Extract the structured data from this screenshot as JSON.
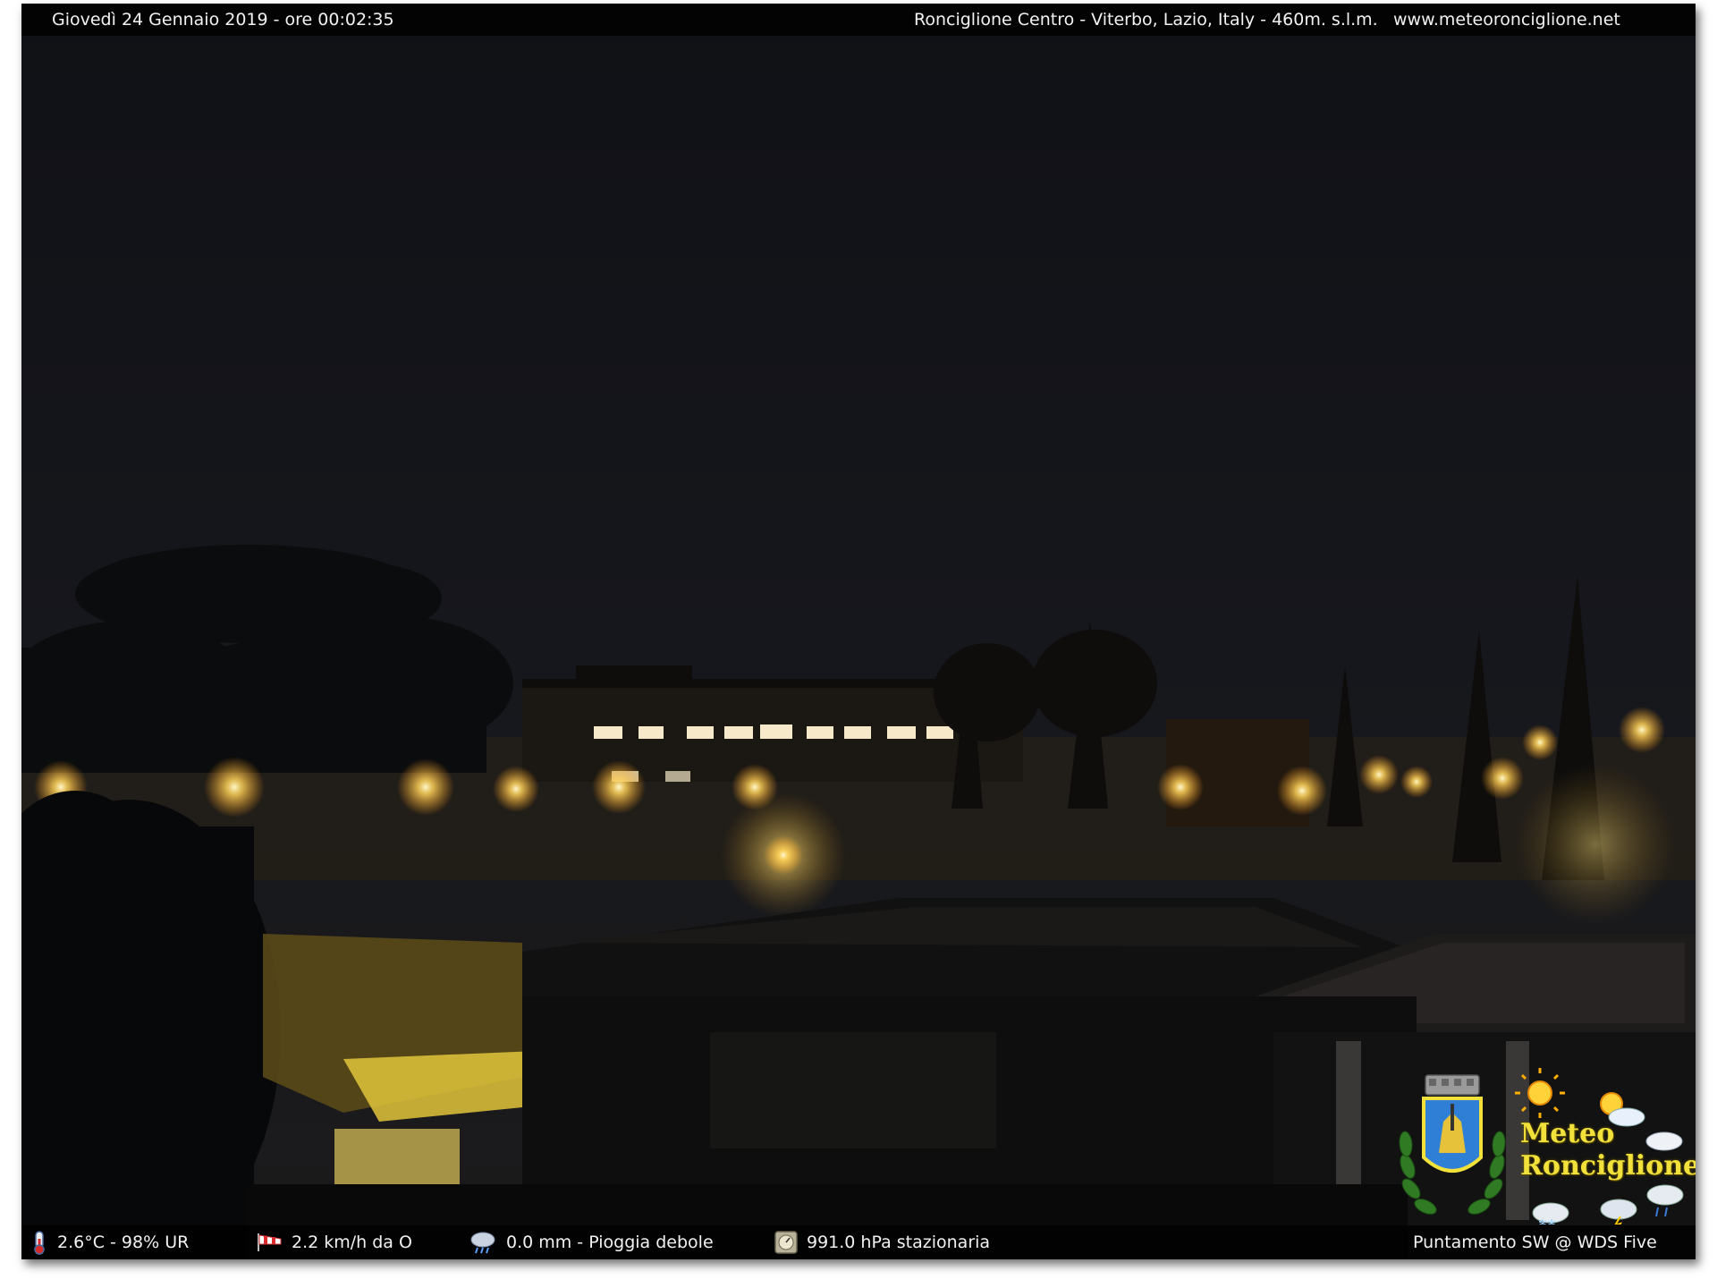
{
  "header": {
    "datetime": "Giovedì 24 Gennaio 2019 - ore 00:02:35",
    "location": "Ronciglione Centro - Viterbo, Lazio, Italy - 460m. s.l.m.",
    "website": "www.meteoronciglione.net"
  },
  "footer": {
    "temperature": {
      "icon": "thermometer-icon",
      "text": "2.6°C - 98% UR"
    },
    "wind": {
      "icon": "windsock-icon",
      "text": "2.2 km/h da O"
    },
    "rain": {
      "icon": "rain-cloud-icon",
      "text": "0.0 mm - Pioggia debole"
    },
    "pressure": {
      "icon": "barometer-icon",
      "text": "991.0 hPa stazionaria"
    },
    "pointing": "Puntamento SW  @ WDS Five"
  },
  "logo": {
    "line1": "Meteo",
    "line2": "Ronciglione",
    "icons": [
      "crest-icon",
      "sun-icon",
      "sun-cloud-icon",
      "cloud-icon",
      "rain-icon",
      "snow-icon",
      "storm-icon"
    ]
  },
  "colors": {
    "sky": "#16171c",
    "streetlight": "#ffd35a",
    "logo_text": "#f1e13a",
    "crest_blue": "#2f7fd6"
  }
}
